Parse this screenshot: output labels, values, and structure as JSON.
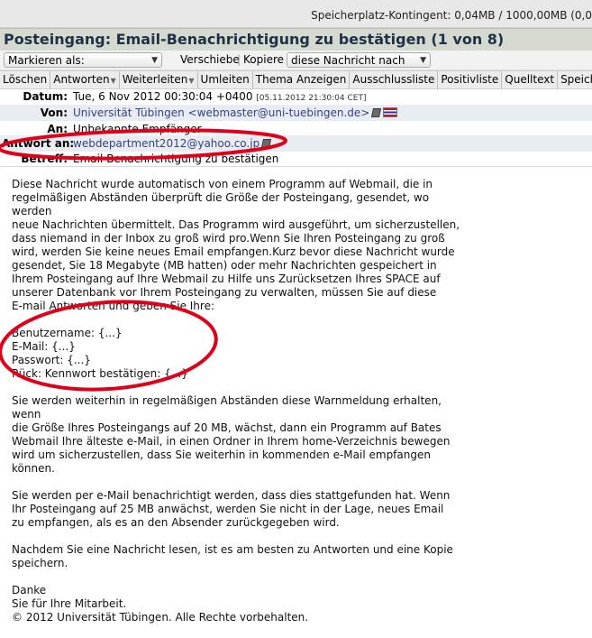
{
  "quota": {
    "text": "Speicherplatz-Kontingent: 0,04MB / 1000,00MB (0,0"
  },
  "window": {
    "title": "Posteingang: Email-Benachrichtigung zu bestätigen (1 von 8)"
  },
  "actions": {
    "mark_as_value": "Markieren als:",
    "move_label": "Verschiebe",
    "copy_label": "Kopiere",
    "target_value": "diese Nachricht nach"
  },
  "toolbar": {
    "items": [
      "Löschen",
      "Antworten",
      "Weiterleiten",
      "Umleiten",
      "Thema Anzeigen",
      "Ausschlussliste",
      "Positivliste",
      "Quelltext",
      "Speichern un"
    ]
  },
  "headers": {
    "date": {
      "label": "Datum:",
      "value": "Tue, 6 Nov 2012 00:30:04 +0400",
      "local_time": "[05.11.2012 21:30:04 CET]"
    },
    "from": {
      "label": "Von:",
      "value": "Universität Tübingen <webmaster@uni-tuebingen.de>"
    },
    "to": {
      "label": "An:",
      "value": "Unbekannte Empfänger"
    },
    "reply_to": {
      "label": "Antwort an:",
      "value": "webdepartment2012@yahoo.co.jp"
    },
    "subject": {
      "label": "Betreff:",
      "value": "Email-Benachrichtigung zu bestätigen"
    }
  },
  "message": {
    "intro_lines": [
      "Diese Nachricht wurde automatisch von einem Programm auf Webmail, die in",
      "regelmäßigen Abständen überprüft die Größe der Posteingang, gesendet, wo werden",
      "neue Nachrichten übermittelt. Das Programm wird ausgeführt, um sicherzustellen,",
      "dass niemand in der Inbox zu groß wird pro.Wenn Sie Ihren Posteingang zu groß",
      "wird, werden Sie keine neues Email empfangen.Kurz bevor diese Nachricht wurde",
      "gesendet, Sie 18 Megabyte (MB hatten) oder mehr Nachrichten gespeichert in",
      "Ihrem Posteingang auf Ihre Webmail zu Hilfe uns Zurücksetzen Ihres SPACE auf",
      "unserer Datenbank vor Ihrem Posteingang zu verwalten, müssen Sie auf diese",
      "E-mail Antworten und geben Sie Ihre:"
    ],
    "form_lines": [
      "Benutzername: {...}",
      "E-Mail: {...}",
      "Passwort: {...}",
      "Rück: Kennwort bestätigen: {...}"
    ],
    "warning_lines": [
      "Sie werden weiterhin in regelmäßigen Abständen diese Warnmeldung erhalten, wenn",
      "die Größe Ihres Posteingangs auf 20 MB, wächst, dann ein Programm auf Bates",
      "Webmail Ihre älteste e-Mail, in einen Ordner in Ihrem home-Verzeichnis bewegen",
      "wird um sicherzustellen, dass Sie weiterhin in kommenden e-Mail empfangen",
      "können."
    ],
    "notice_lines": [
      "Sie werden per e-Mail benachrichtigt werden, dass dies stattgefunden hat. Wenn",
      "Ihr Posteingang auf 25 MB anwächst, werden Sie nicht in der Lage, neues Email",
      "zu empfangen, als es an den Absender zurückgegeben wird."
    ],
    "advice_line": "Nachdem Sie eine Nachricht lesen, ist es am besten zu Antworten und eine Kopie",
    "advice_line2": "speichern.",
    "closing_lines": [
      "Danke",
      "Sie für Ihre Mitarbeit.",
      "© 2012 Universität Tübingen. Alle Rechte vorbehalten."
    ]
  },
  "annotation_color": "#e0001a",
  "link_color": "#33428a"
}
